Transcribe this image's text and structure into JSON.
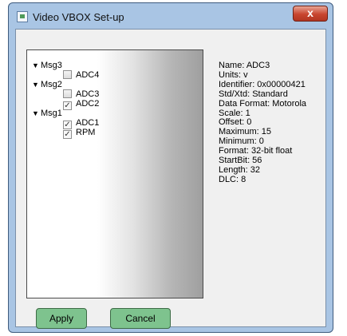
{
  "window": {
    "title": "Video VBOX Set-up",
    "close_label": "x"
  },
  "tree": [
    {
      "label": "Msg3",
      "type": "group",
      "expanded": true
    },
    {
      "label": "ADC4",
      "type": "item",
      "checked": false
    },
    {
      "label": "Msg2",
      "type": "group",
      "expanded": true
    },
    {
      "label": "ADC3",
      "type": "item",
      "checked": false,
      "selected": true
    },
    {
      "label": "ADC2",
      "type": "item",
      "checked": true
    },
    {
      "label": "Msg1",
      "type": "group",
      "expanded": true
    },
    {
      "label": "ADC1",
      "type": "item",
      "checked": true
    },
    {
      "label": "RPM",
      "type": "item",
      "checked": true
    }
  ],
  "details": [
    "Name: ADC3",
    "Units: v",
    "Identifier: 0x00000421",
    "Std/Xtd: Standard",
    "Data Format: Motorola",
    "Scale: 1",
    "Offset: 0",
    "Maximum: 15",
    "Minimum: 0",
    "Format: 32-bit float",
    "StartBit: 56",
    "Length: 32",
    "DLC: 8"
  ],
  "buttons": {
    "apply": "Apply",
    "cancel": "Cancel"
  },
  "colors": {
    "button_green": "#7ec38e",
    "frame_blue": "#a9c5e4",
    "close_red": "#c8452f"
  }
}
